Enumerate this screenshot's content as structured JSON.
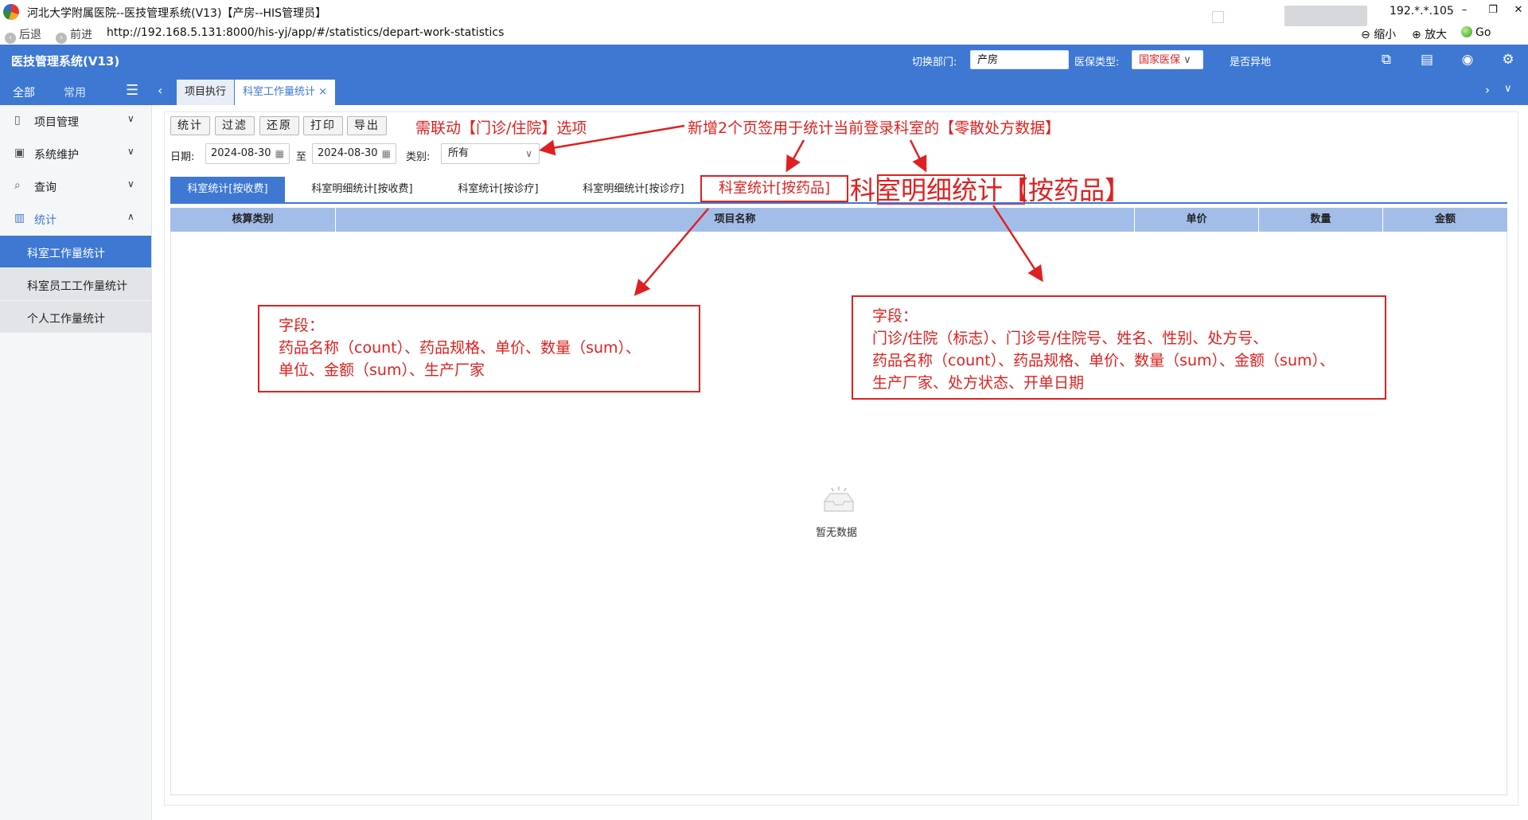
{
  "window": {
    "title": "河北大学附属医院--医技管理系统(V13)【产房--HIS管理员】",
    "ip": "192.*.*.105",
    "buttons": {
      "minimize": "–",
      "restore": "❐",
      "close": "✕"
    }
  },
  "nav": {
    "back": "后退",
    "forward": "前进",
    "url": "http://192.168.5.131:8000/his-yj/app/#/statistics/depart-work-statistics",
    "zoom_out": "缩小",
    "zoom_in": "放大",
    "go": "Go"
  },
  "header": {
    "app_name": "医技管理系统(V13)",
    "switch_dept_label": "切换部门:",
    "dept_value": "产房",
    "insurance_label": "医保类型:",
    "insurance_value": "国家医保",
    "remote_label": "是否异地",
    "icons": [
      "monitor-icon",
      "document-icon",
      "eye-icon",
      "settings-icon"
    ]
  },
  "sidebar": {
    "tabs": [
      "全部",
      "常用"
    ],
    "items": [
      {
        "label": "项目管理",
        "icon": "project-icon"
      },
      {
        "label": "系统维护",
        "icon": "system-icon"
      },
      {
        "label": "查询",
        "icon": "search-icon"
      },
      {
        "label": "统计",
        "icon": "stats-icon"
      }
    ],
    "sub_items": [
      "科室工作量统计",
      "科室员工工作量统计",
      "个人工作量统计"
    ]
  },
  "tabs": [
    {
      "label": "项目执行"
    },
    {
      "label": "科室工作量统计 ×"
    }
  ],
  "toolbar": {
    "stat": "统计",
    "filter": "过滤",
    "restore": "还原",
    "print": "打印",
    "export": "导出"
  },
  "filters": {
    "date_label": "日期:",
    "date_from": "2024-08-30",
    "to_label": "至",
    "date_to": "2024-08-30",
    "type_label": "类别:",
    "type_value": "所有"
  },
  "page_tabs": [
    "科室统计[按收费]",
    "科室明细统计[按收费]",
    "科室统计[按诊疗]",
    "科室明细统计[按诊疗]",
    "科室统计[按药品]",
    "科室明细统计【按药品】"
  ],
  "table": {
    "columns": [
      "核算类别",
      "项目名称",
      "单价",
      "数量",
      "金额"
    ],
    "empty_text": "暂无数据"
  },
  "annotations": {
    "linkage_note": "需联动【门诊/住院】选项",
    "new_tabs_note": "新增2个页签用于统计当前登录科室的【零散处方数据】",
    "box1": {
      "title": "字段：",
      "lines": [
        "药品名称（count）、药品规格、单价、数量（sum）、",
        "单位、金额（sum）、生产厂家"
      ]
    },
    "box2": {
      "title": "字段：",
      "lines": [
        "门诊/住院（标志）、门诊号/住院号、姓名、性别、处方号、",
        "药品名称（count）、药品规格、单价、数量（sum）、金额（sum）、",
        "生产厂家、处方状态、开单日期"
      ]
    },
    "color": "#e02020"
  },
  "colors": {
    "primary": "#3e78d3",
    "table_header": "#a3bde9",
    "annotation": "#e02020"
  }
}
